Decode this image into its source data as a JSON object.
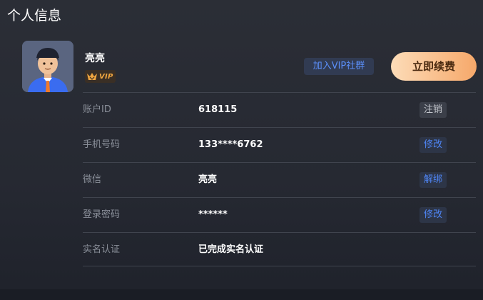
{
  "page": {
    "title": "个人信息"
  },
  "profile": {
    "name": "亮亮",
    "vip_label": "VIP",
    "join_vip_label": "加入VIP社群",
    "renew_label": "立即续费"
  },
  "rows": [
    {
      "label": "账户ID",
      "value": "618115",
      "action": "注销"
    },
    {
      "label": "手机号码",
      "value": "133****6762",
      "action": "修改"
    },
    {
      "label": "微信",
      "value": "亮亮",
      "action": "解绑"
    },
    {
      "label": "登录密码",
      "value": "******",
      "action": "修改"
    },
    {
      "label": "实名认证",
      "value": "已完成实名认证"
    }
  ],
  "colors": {
    "background": "#2b2e36",
    "accent_blue": "#4f86f7",
    "renew_gradient_start": "#fcdcb8",
    "renew_gradient_end": "#f6a86a",
    "vip_gold": "#f0a640"
  }
}
